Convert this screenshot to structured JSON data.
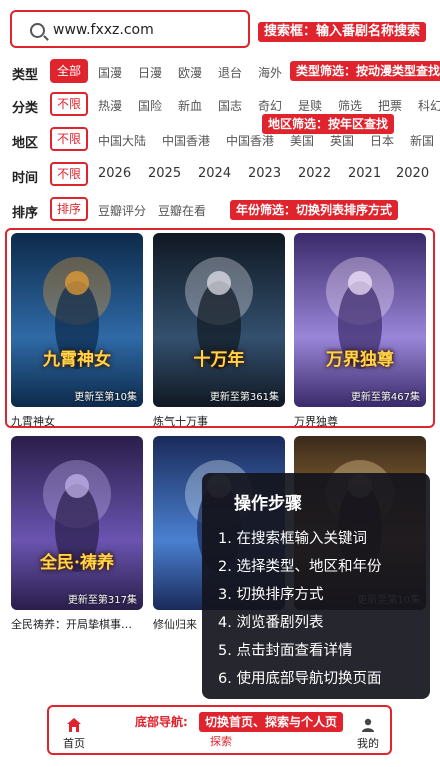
{
  "search": {
    "value": "www.fxxz.com",
    "tag": "搜索框：输入番剧名称搜索"
  },
  "filters": {
    "type": {
      "label": "类型",
      "selected": "全部",
      "options": [
        "国漫",
        "日漫",
        "欧漫",
        "退台",
        "海外"
      ],
      "tag": "类型筛选：按动漫类型查找"
    },
    "category": {
      "label": "分类",
      "selected": "不限",
      "options": [
        "热漫",
        "国险",
        "新血",
        "国志",
        "奇幻",
        "是赎",
        "筛选",
        "把票",
        "科幻"
      ]
    },
    "region": {
      "label": "地区",
      "selected": "不限",
      "options": [
        "中国大陆",
        "中国香港",
        "中国香港",
        "美国",
        "英国",
        "日本",
        "新国"
      ],
      "tag": "地区筛选：按年区查找"
    },
    "time": {
      "label": "时间",
      "selected": "不限",
      "options": [
        "2026",
        "2025",
        "2024",
        "2023",
        "2022",
        "2021",
        "2020"
      ]
    },
    "sort": {
      "label": "排序",
      "selected": "排序",
      "options": [
        "豆瓣评分",
        "豆瓣在看"
      ],
      "tag": "年份筛选：切换列表排序方式"
    }
  },
  "cards_row1": [
    {
      "title": "九霄神女",
      "cover_text": "九霄神女",
      "badge": "更新至第10集",
      "colors": [
        "#0d2a4a",
        "#2f6aa6",
        "#f0a030"
      ]
    },
    {
      "title": "炼气十万事",
      "cover_text": "十万年",
      "badge": "更新至第361集",
      "colors": [
        "#101822",
        "#33506e",
        "#e8e8f0"
      ]
    },
    {
      "title": "万界独尊",
      "cover_text": "万界独尊",
      "badge": "更新至第467集",
      "colors": [
        "#3a2a6a",
        "#9a86d8",
        "#f8e8ff"
      ]
    }
  ],
  "cards_row2": [
    {
      "title": "全民祷养：开局挚棋事…",
      "cover_text": "全民·祷养",
      "badge": "更新至第317集",
      "colors": [
        "#2a1e4a",
        "#6a54b0",
        "#c8b8f0"
      ]
    },
    {
      "title": "修仙归来",
      "cover_text": "",
      "badge": "",
      "colors": [
        "#1a2a5a",
        "#4a80d0",
        "#e0f0ff"
      ]
    },
    {
      "title": "",
      "cover_text": "",
      "badge": "更新至第10集",
      "colors": [
        "#3a2a1a",
        "#b08040",
        "#f0d8a0"
      ]
    }
  ],
  "steps": {
    "title": "操作步骤",
    "items": [
      "1. 在搜索框输入关键词",
      "2. 选择类型、地区和年份",
      "3. 切换排序方式",
      "4. 浏览番剧列表",
      "5. 点击封面查看详情",
      "6. 使用底部导航切换页面"
    ]
  },
  "bottom_nav": {
    "label": "底部导航:",
    "tag": "切换首页、探索与个人页",
    "items": [
      {
        "label": "首页",
        "icon": "home-icon"
      },
      {
        "label": "探索",
        "icon": "explore-icon"
      },
      {
        "label": "我的",
        "icon": "user-icon"
      }
    ]
  },
  "accent": "#e0242e"
}
